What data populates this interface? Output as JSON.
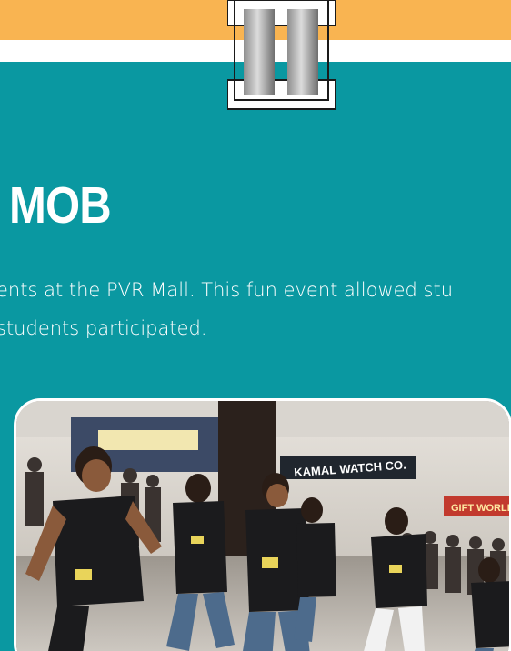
{
  "article": {
    "title": "MOB",
    "body_line_1": "ents at the PVR Mall. This fun event allowed stu",
    "body_line_2": " students participated."
  },
  "photo": {
    "signage_text": "KAMAL WATCH CO.",
    "signage_text_2": "GIFT WORLD"
  },
  "colors": {
    "background_teal": "#0a98a1",
    "top_band_orange": "#f9b451",
    "text": "#ffffff"
  },
  "icons": {
    "clip": "binder-clip-icon"
  }
}
